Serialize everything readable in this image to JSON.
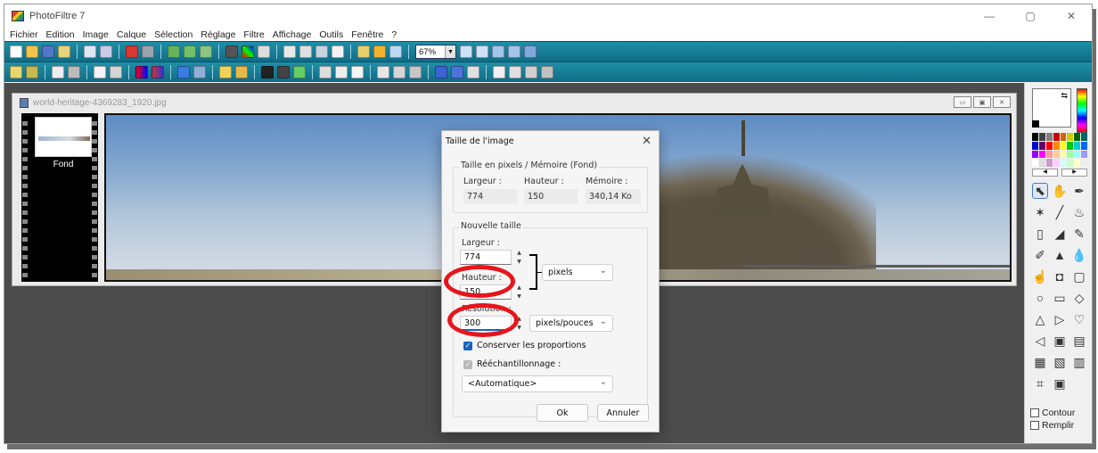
{
  "window": {
    "title": "PhotoFiltre 7",
    "controls": [
      "—",
      "▢",
      "✕"
    ]
  },
  "menu": [
    "Fichier",
    "Edition",
    "Image",
    "Calque",
    "Sélection",
    "Réglage",
    "Filtre",
    "Affichage",
    "Outils",
    "Fenêtre",
    "?"
  ],
  "toolbar": {
    "zoom_value": "67%"
  },
  "document": {
    "filename": "world-heritage-4369283_1920.jpg",
    "layer_label": "Fond"
  },
  "dialog": {
    "title": "Taille de l'image",
    "close": "✕",
    "current_group": "Taille en pixels / Mémoire (Fond)",
    "current": {
      "width_label": "Largeur :",
      "width": "774",
      "height_label": "Hauteur :",
      "height": "150",
      "memory_label": "Mémoire :",
      "memory": "340,14 Ko"
    },
    "new_group": "Nouvelle taille",
    "new": {
      "width_label": "Largeur :",
      "width": "774",
      "height_label": "Hauteur :",
      "height": "150",
      "unit": "pixels",
      "resolution_label": "Résolution :",
      "resolution": "300",
      "resolution_unit": "pixels/pouces"
    },
    "keep_proportions": "Conserver les proportions",
    "resample": "Rééchantillonnage :",
    "resample_mode": "<Automatique>",
    "ok": "Ok",
    "cancel": "Annuler"
  },
  "side_panel": {
    "contour": "Contour",
    "fill": "Remplir"
  },
  "colors": {
    "annotation_red": "#e8141b",
    "toolbar_teal": "#1a8199"
  }
}
